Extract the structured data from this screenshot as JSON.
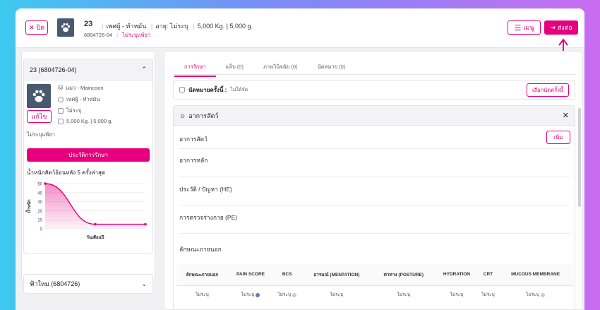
{
  "header": {
    "close_label": "ปิด",
    "pet_id": "23",
    "owner": "เพศผู้ - ทำหมัน",
    "age_label": "อายุ: ไม่ระบุ",
    "weight": "5,000 Kg. | 5,000 g.",
    "hn": "6804726-04",
    "allergy": "ไม่ระบุแพ้ยา",
    "menu_label": "เมนู",
    "send_label": "ส่งต่อ"
  },
  "left": {
    "card_title": "23 (6804726-04)",
    "species": "แมว - Maincoon",
    "gender": "เพศผู้ - ทำหมัน",
    "age": "ไม่ระบุ",
    "weight": "5,000 Kg. | 5,000 g.",
    "edit_label": "แก้ไข",
    "allergy": "ไม่ระบุแพ้ยา",
    "history_button": "ประวัติการรักษา",
    "chart_title": "น้ำหนักสัตว์ย้อนหลัง 5 ครั้งล่าสุด",
    "owner_card": "ฟ้าใหม (6804726)"
  },
  "chart_data": {
    "type": "area",
    "title": "น้ำหนักสัตว์ย้อนหลัง 5 ครั้งล่าสุด",
    "xlabel": "วันเดือนปี",
    "ylabel": "น้ำหนัก",
    "ylim": [
      0,
      50
    ],
    "yticks": [
      "0",
      "10",
      "20",
      "30",
      "40",
      "50"
    ],
    "series": [
      {
        "values": [
          50,
          5,
          5
        ]
      }
    ],
    "color": "#e6007e"
  },
  "tabs": [
    {
      "label": "การรักษา"
    },
    {
      "label": "แล็บ (0)"
    },
    {
      "label": "ภาพวินิจฉัย (0)"
    },
    {
      "label": "นัดหมาย (0)"
    }
  ],
  "appointment": {
    "label": "นัดหมายครั้งนี้ :",
    "value": "ไม่ได้จัด",
    "button": "เลือกนัดครั้งนี้"
  },
  "symptoms": {
    "title": "อาการสัตว์",
    "section_label": "อาการสัตว์",
    "add_button": "เพิ่ม",
    "main_label": "อาการหลัก",
    "history_label": "ประวัติ / ปัญหา (HE)",
    "pe_label": "การตรวจร่างกาย (PE)",
    "external_label": "ลักษณะภายนอก"
  },
  "vitals": {
    "headers": [
      "ลักษณะภายนอก",
      "PAIN SCORE",
      "BCS",
      "อารมณ์ (MENTATION)",
      "ท่าทาง (POSTURE)",
      "HYDRATION",
      "CRT",
      "MUCOUS MEMBRANE"
    ],
    "values": [
      "ไม่ระบุ",
      "ไม่ระบุ",
      "ไม่ระบุ",
      "ไม่ระบุ",
      "ไม่ระบุ",
      "ไม่ระบุ",
      "ไม่ระบุ",
      "ไม่ระบุ"
    ]
  }
}
